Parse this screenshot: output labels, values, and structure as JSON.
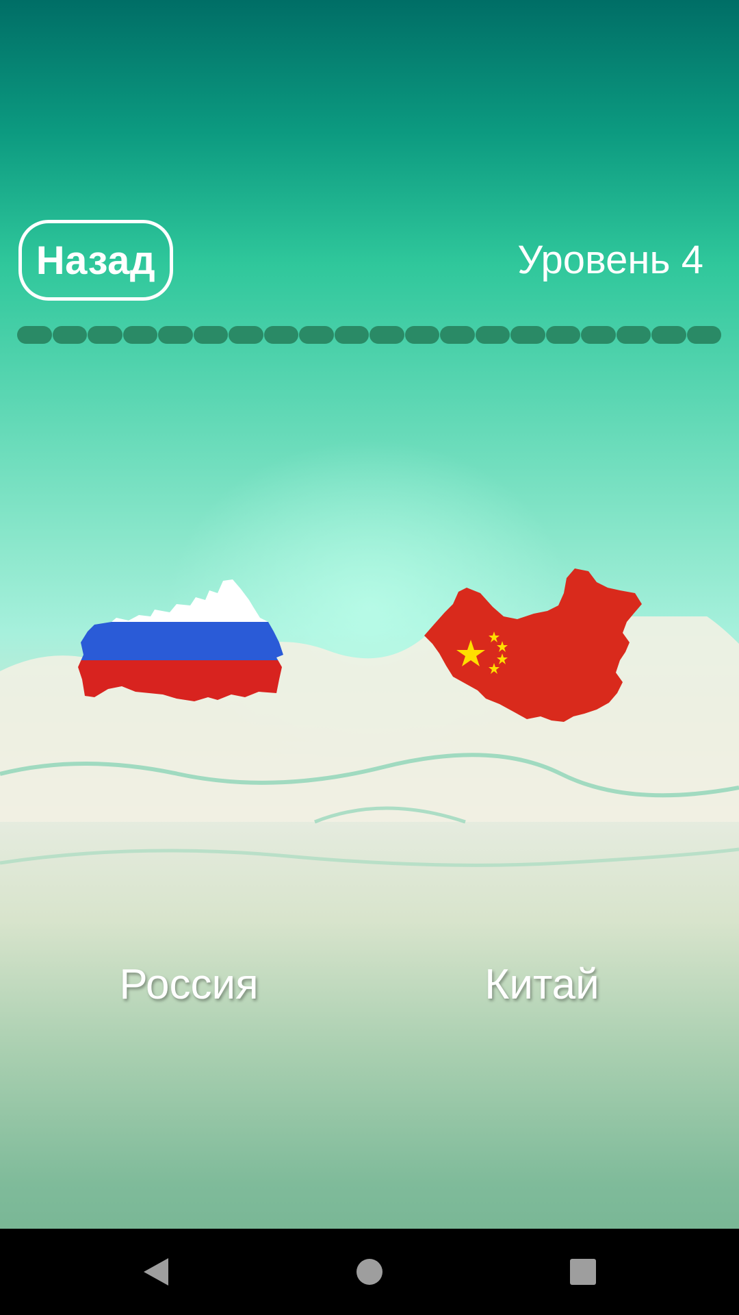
{
  "header": {
    "back_label": "Назад",
    "level_label": "Уровень 4"
  },
  "progress": {
    "segments_total": 20,
    "segments_completed": 0,
    "segment_color": "#2a8a66"
  },
  "choices": [
    {
      "name": "Россия",
      "map_icon": "russia-flag-map-icon"
    },
    {
      "name": "Китай",
      "map_icon": "china-flag-map-icon"
    }
  ],
  "navbar": {
    "icons": [
      "back-triangle-icon",
      "home-circle-icon",
      "recents-square-icon"
    ],
    "icon_color": "#9e9e9e"
  }
}
